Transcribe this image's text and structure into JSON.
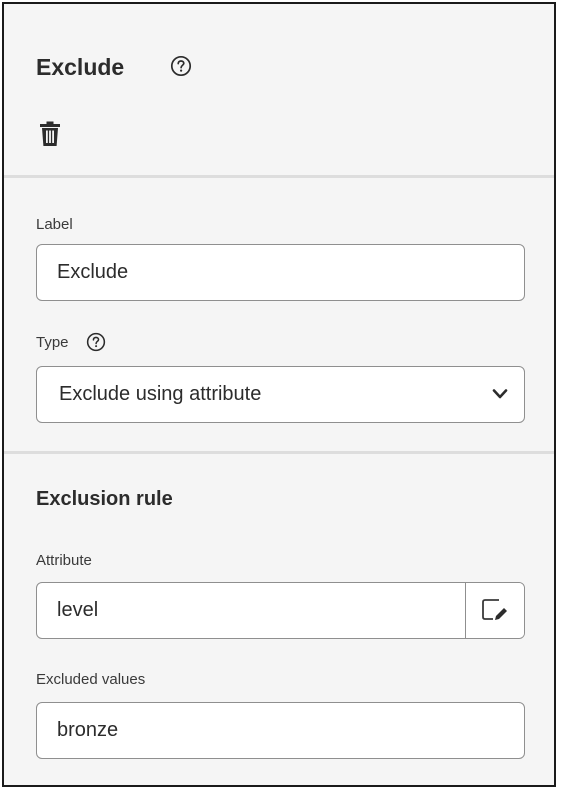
{
  "header": {
    "title": "Exclude",
    "help_icon": "help-circle-icon",
    "delete_icon": "trash-icon"
  },
  "general": {
    "label_field": {
      "label": "Label",
      "value": "Exclude"
    },
    "type_field": {
      "label": "Type",
      "help_icon": "help-circle-icon",
      "value": "Exclude using attribute",
      "dropdown_icon": "chevron-down-icon"
    }
  },
  "exclusion_rule": {
    "title": "Exclusion rule",
    "attribute_field": {
      "label": "Attribute",
      "value": "level",
      "edit_icon": "edit-attribute-icon"
    },
    "excluded_values_field": {
      "label": "Excluded values",
      "value": "bronze"
    }
  }
}
